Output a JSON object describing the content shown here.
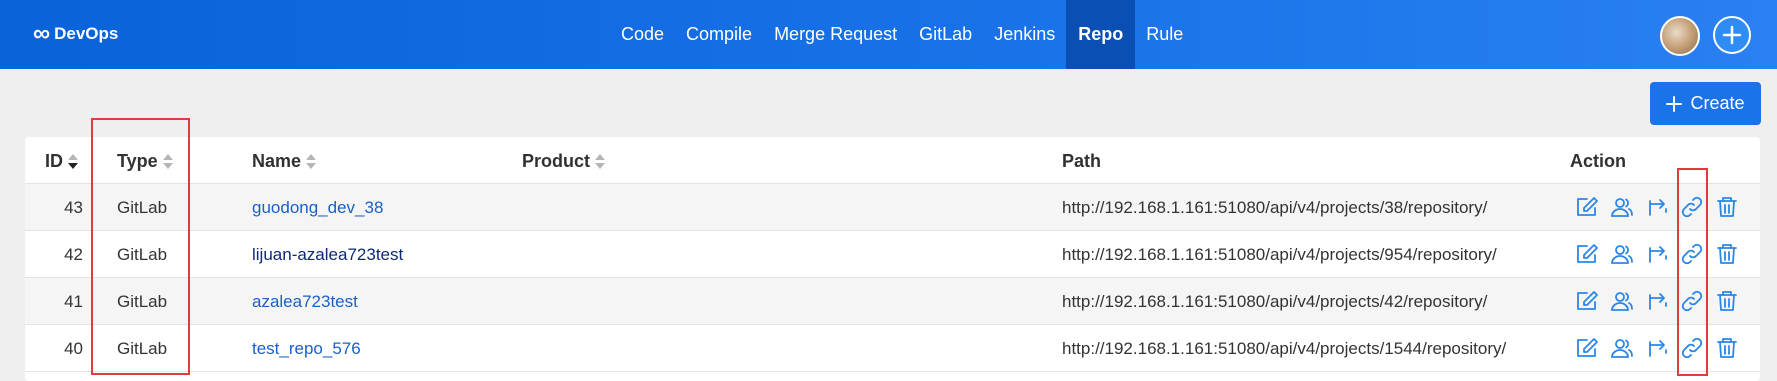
{
  "header": {
    "logo_text": "DevOps",
    "nav": [
      "Code",
      "Compile",
      "Merge Request",
      "GitLab",
      "Jenkins",
      "Repo",
      "Rule"
    ],
    "active_nav": "Repo"
  },
  "toolbar": {
    "create_label": "Create"
  },
  "table": {
    "columns": {
      "id": "ID",
      "type": "Type",
      "name": "Name",
      "product": "Product",
      "path": "Path",
      "action": "Action"
    },
    "rows": [
      {
        "id": "43",
        "type": "GitLab",
        "name": "guodong_dev_38",
        "product": "",
        "path": "http://192.168.1.161:51080/api/v4/projects/38/repository/"
      },
      {
        "id": "42",
        "type": "GitLab",
        "name": "lijuan-azalea723test",
        "product": "",
        "path": "http://192.168.1.161:51080/api/v4/projects/954/repository/"
      },
      {
        "id": "41",
        "type": "GitLab",
        "name": "azalea723test",
        "product": "",
        "path": "http://192.168.1.161:51080/api/v4/projects/42/repository/"
      },
      {
        "id": "40",
        "type": "GitLab",
        "name": "test_repo_576",
        "product": "",
        "path": "http://192.168.1.161:51080/api/v4/projects/1544/repository/"
      }
    ],
    "action_icons": [
      "edit-icon",
      "members-icon",
      "branch-icon",
      "link-icon",
      "delete-icon"
    ]
  },
  "colors": {
    "accent": "#1a73e8",
    "link": "#1a60c8",
    "highlight": "#e23b3b"
  }
}
